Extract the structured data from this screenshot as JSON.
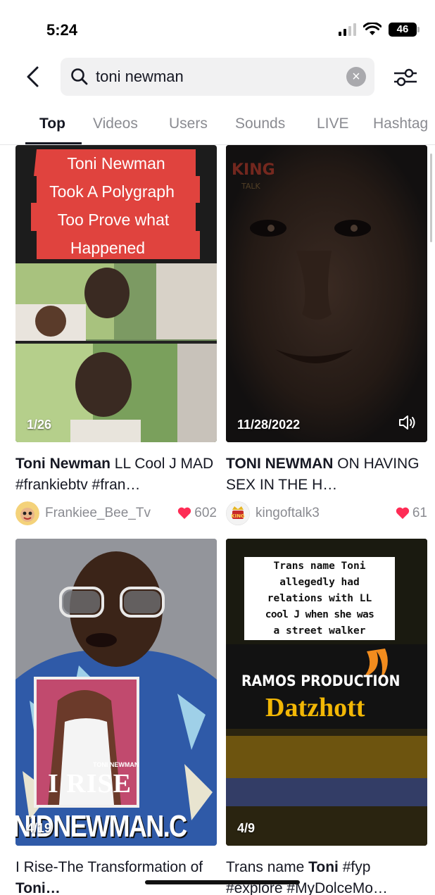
{
  "status": {
    "time": "5:24",
    "battery": "46"
  },
  "search": {
    "query": "toni newman"
  },
  "tabs": [
    {
      "label": "Top"
    },
    {
      "label": "Videos"
    },
    {
      "label": "Users"
    },
    {
      "label": "Sounds"
    },
    {
      "label": "LIVE"
    },
    {
      "label": "Hashtag"
    }
  ],
  "results": [
    {
      "overlay_text": [
        "Toni Newman",
        "Took A Polygraph",
        "Too Prove what",
        "Happened"
      ],
      "label": "1/26",
      "caption_bold": "Toni Newman",
      "caption_rest": " LL Cool J MAD #frankiebtv #fran…",
      "author": "Frankiee_Bee_Tv",
      "likes": "602"
    },
    {
      "label": "11/28/2022",
      "caption_bold": "TONI NEWMAN",
      "caption_rest": " ON HAVING SEX IN THE H…",
      "author": "kingoftalk3",
      "likes": "61"
    },
    {
      "book_title": "I RISE",
      "book_author": "TONI NEWMAN",
      "banner": "NIDNEWMAN.C",
      "label": "4/19",
      "caption_pre": "I Rise-The Transformation of ",
      "caption_bold": "Toni…"
    },
    {
      "overlay_text": [
        "Trans name Toni",
        "allegedly had",
        "relations with LL",
        "cool J when she was",
        "a street walker"
      ],
      "production": "RAMOS PRODUCTION",
      "brand": "Datzhott",
      "label": "4/9",
      "caption_pre": "Trans name ",
      "caption_bold": "Toni",
      "caption_rest": " #fyp #explore #MyDolceMo…"
    }
  ],
  "colors": {
    "accent_red": "#fe2c55",
    "text_primary": "#161823",
    "text_secondary": "#8a8b91"
  }
}
